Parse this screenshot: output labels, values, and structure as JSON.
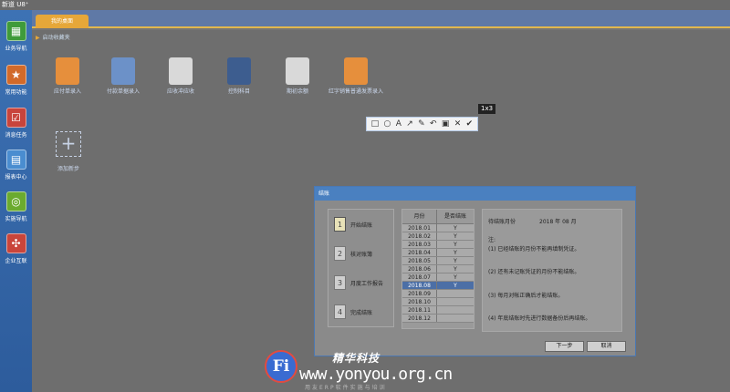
{
  "window": {
    "title": "新道 U8⁺"
  },
  "sidebar": {
    "items": [
      {
        "label": "业务导航",
        "icon": "flowchart-icon",
        "glyph": "▦",
        "color": "#3f9b3a"
      },
      {
        "label": "常用功能",
        "icon": "star-icon",
        "glyph": "★",
        "color": "#d26a2a"
      },
      {
        "label": "消息任务",
        "icon": "task-icon",
        "glyph": "☑",
        "color": "#c8443c"
      },
      {
        "label": "报表中心",
        "icon": "report-icon",
        "glyph": "▤",
        "color": "#4a8dd0"
      },
      {
        "label": "实施导航",
        "icon": "compass-icon",
        "glyph": "◎",
        "color": "#6bab2f"
      },
      {
        "label": "企业互联",
        "icon": "network-icon",
        "glyph": "✣",
        "color": "#c9453b"
      }
    ]
  },
  "tabs": {
    "home": "我的桌面"
  },
  "favorites": {
    "header": "启动收藏夹",
    "items": [
      {
        "label": "应付单录入",
        "icon": "ledger-icon",
        "color": "#e68f3c"
      },
      {
        "label": "付款单据录入",
        "icon": "people-icon",
        "color": "#6c91c8"
      },
      {
        "label": "应收冲应收",
        "icon": "doc-star-icon",
        "color": "#d9d9d9"
      },
      {
        "label": "控制科目",
        "icon": "binder-icon",
        "color": "#3d5d8f"
      },
      {
        "label": "期初余额",
        "icon": "doc-star-icon",
        "color": "#d9d9d9"
      },
      {
        "label": "红字销售普通发票录入",
        "icon": "ledger-icon",
        "color": "#e68f3c"
      }
    ],
    "add_label": "添加新步",
    "add_glyph": "+"
  },
  "capture": {
    "size_label": "1x3",
    "tools": [
      {
        "name": "rectangle-tool-icon",
        "glyph": "□"
      },
      {
        "name": "ellipse-tool-icon",
        "glyph": "○"
      },
      {
        "name": "text-tool-icon",
        "glyph": "A"
      },
      {
        "name": "arrow-tool-icon",
        "glyph": "↗"
      },
      {
        "name": "pen-tool-icon",
        "glyph": "✎"
      },
      {
        "name": "undo-tool-icon",
        "glyph": "↶"
      },
      {
        "name": "save-tool-icon",
        "glyph": "▣"
      },
      {
        "name": "close-tool-icon",
        "glyph": "✕"
      },
      {
        "name": "confirm-tool-icon",
        "glyph": "✔"
      }
    ]
  },
  "dialog": {
    "title": "结账",
    "steps": [
      {
        "num": "1",
        "label": "开始结账"
      },
      {
        "num": "2",
        "label": "核对账簿"
      },
      {
        "num": "3",
        "label": "月度工作报告"
      },
      {
        "num": "4",
        "label": "完成结账"
      }
    ],
    "grid": {
      "col_month": "月份",
      "col_closed": "是否结账",
      "rows": [
        {
          "month": "2018.01",
          "closed": "Y"
        },
        {
          "month": "2018.02",
          "closed": "Y"
        },
        {
          "month": "2018.03",
          "closed": "Y"
        },
        {
          "month": "2018.04",
          "closed": "Y"
        },
        {
          "month": "2018.05",
          "closed": "Y"
        },
        {
          "month": "2018.06",
          "closed": "Y"
        },
        {
          "month": "2018.07",
          "closed": "Y"
        },
        {
          "month": "2018.08",
          "closed": "Y"
        },
        {
          "month": "2018.09",
          "closed": ""
        },
        {
          "month": "2018.10",
          "closed": ""
        },
        {
          "month": "2018.11",
          "closed": ""
        },
        {
          "month": "2018.12",
          "closed": ""
        }
      ]
    },
    "info": {
      "pending_label": "待结账月份",
      "pending_value": "2018 年 08 月",
      "note_title": "注:",
      "notes": [
        "(1) 已经结账的月份不能再填制凭证。",
        "(2) 还有未记账凭证的月份不能结账。",
        "(3) 每月对帐正确后才能结账。",
        "(4) 年底结账时先进行数据备份后再结账。"
      ]
    },
    "next_label": "下一步",
    "cancel_label": "取消"
  },
  "watermark": {
    "logo_text": "Fi",
    "brand": "精华科技",
    "url": "www.yonyou.org.cn",
    "subtext": "用友ERP软件实施与培训"
  }
}
